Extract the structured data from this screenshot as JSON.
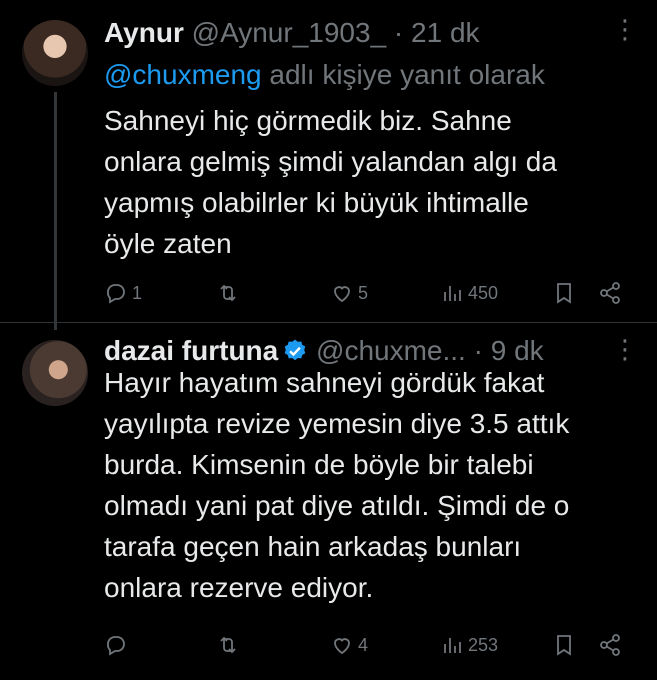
{
  "tweets": [
    {
      "name": "Aynur",
      "handle": "@Aynur_1903_",
      "dot": "·",
      "time": "21 dk",
      "reply_mention": "@chuxmeng",
      "reply_suffix": " adlı kişiye yanıt olarak",
      "body_lines": [
        "Sahneyi hiç görmedik biz. Sahne",
        "onlara gelmiş şimdi yalandan algı da",
        "yapmış olabilrler ki büyük ihtimalle",
        "öyle zaten"
      ],
      "counts": {
        "reply": "1",
        "retweet": "",
        "like": "5",
        "views": "450"
      }
    },
    {
      "name": "dazai furtuna",
      "handle": "@chuxme...",
      "dot": "·",
      "time": "9 dk",
      "verified": true,
      "body_lines": [
        "Hayır hayatım sahneyi gördük fakat",
        "yayılıpta revize yemesin diye 3.5 attık",
        "burda. Kimsenin de böyle bir talebi",
        "olmadı yani pat diye atıldı. Şimdi de o",
        "tarafa geçen hain arkadaş bunları",
        "onlara rezerve ediyor."
      ],
      "counts": {
        "reply": "",
        "retweet": "",
        "like": "4",
        "views": "253"
      }
    }
  ],
  "icons": {
    "more": "more-vertical-icon",
    "reply": "reply-icon",
    "retweet": "retweet-icon",
    "like": "heart-icon",
    "views": "views-icon",
    "bookmark": "bookmark-icon",
    "share": "share-icon",
    "verified": "verified-badge-icon"
  },
  "colors": {
    "background": "#000000",
    "text": "#e7e9ea",
    "muted": "#71767b",
    "link": "#1d9bf0",
    "verified": "#1d9bf0"
  }
}
